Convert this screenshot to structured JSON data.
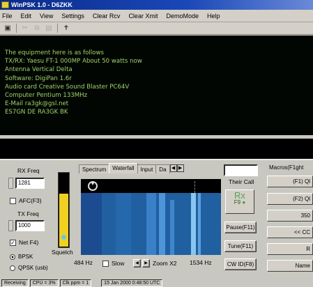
{
  "window": {
    "title": "WinPSK 1.0 - D6ZKK"
  },
  "menu": [
    "File",
    "Edit",
    "View",
    "Settings",
    "Clear Rcv",
    "Clear Xmit",
    "DemoMode",
    "Help"
  ],
  "toolbar": {
    "icons": [
      "save-icon",
      "cut-icon",
      "copy-icon",
      "paste-icon",
      "tune-icon"
    ]
  },
  "receive_text": [
    "The equipment here is as follows",
    "TX/RX: Yaesu FT-1 000MP About 50 watts now",
    "Antenna Vertical Delta",
    "Software: DigiPan 1.6r",
    "Audio card Creative Sound Blaster PC64V",
    "Computer Pentium 133MHz",
    "E-Mail ra3gk@gsl.net",
    "ES7GN DE RA3GK BK"
  ],
  "left_panel": {
    "rx_freq_label": "RX Freq",
    "rx_freq_value": "1281",
    "afc_label": "AFC(F3)",
    "afc_checked": false,
    "tx_freq_label": "TX Freq",
    "tx_freq_value": "1000",
    "net_label": "Net F4)",
    "net_checked": true,
    "mode_options": [
      "BPSK",
      "QPSK (usb)"
    ],
    "mode_selected": "BPSK",
    "squelch_label": "Squelch",
    "squelch_level": 0.72
  },
  "display": {
    "tabs": [
      "Spectrum",
      "Waterfall",
      "Input",
      "Da"
    ],
    "active_tab": "Waterfall",
    "low_freq": "484 Hz",
    "slow_label": "Slow",
    "zoom_label": "Zoom X2",
    "high_freq": "1534 Hz"
  },
  "controls": {
    "their_call_label": "Their Call",
    "their_call_value": "",
    "rx_button_label": "Rx",
    "rx_button_sub": "F9",
    "pause_label": "Pause(F11)",
    "tune_label": "Tune(F11)",
    "cwid_label": "CW ID(F8)"
  },
  "macros": {
    "header": "Macros(F1ght",
    "items": [
      "(F1) Ql",
      "(F2) Ql",
      "350",
      "<< CC",
      "R",
      "Name"
    ]
  },
  "status": [
    "Receiving",
    "CPU = 3%",
    "Clk ppm = 1",
    "15 Jan 2000  0:48:50 UTC"
  ],
  "colors": {
    "rx_text": "#9fd46c",
    "waterfall": "#2060a0",
    "squelch_fill": "#f0d020"
  }
}
